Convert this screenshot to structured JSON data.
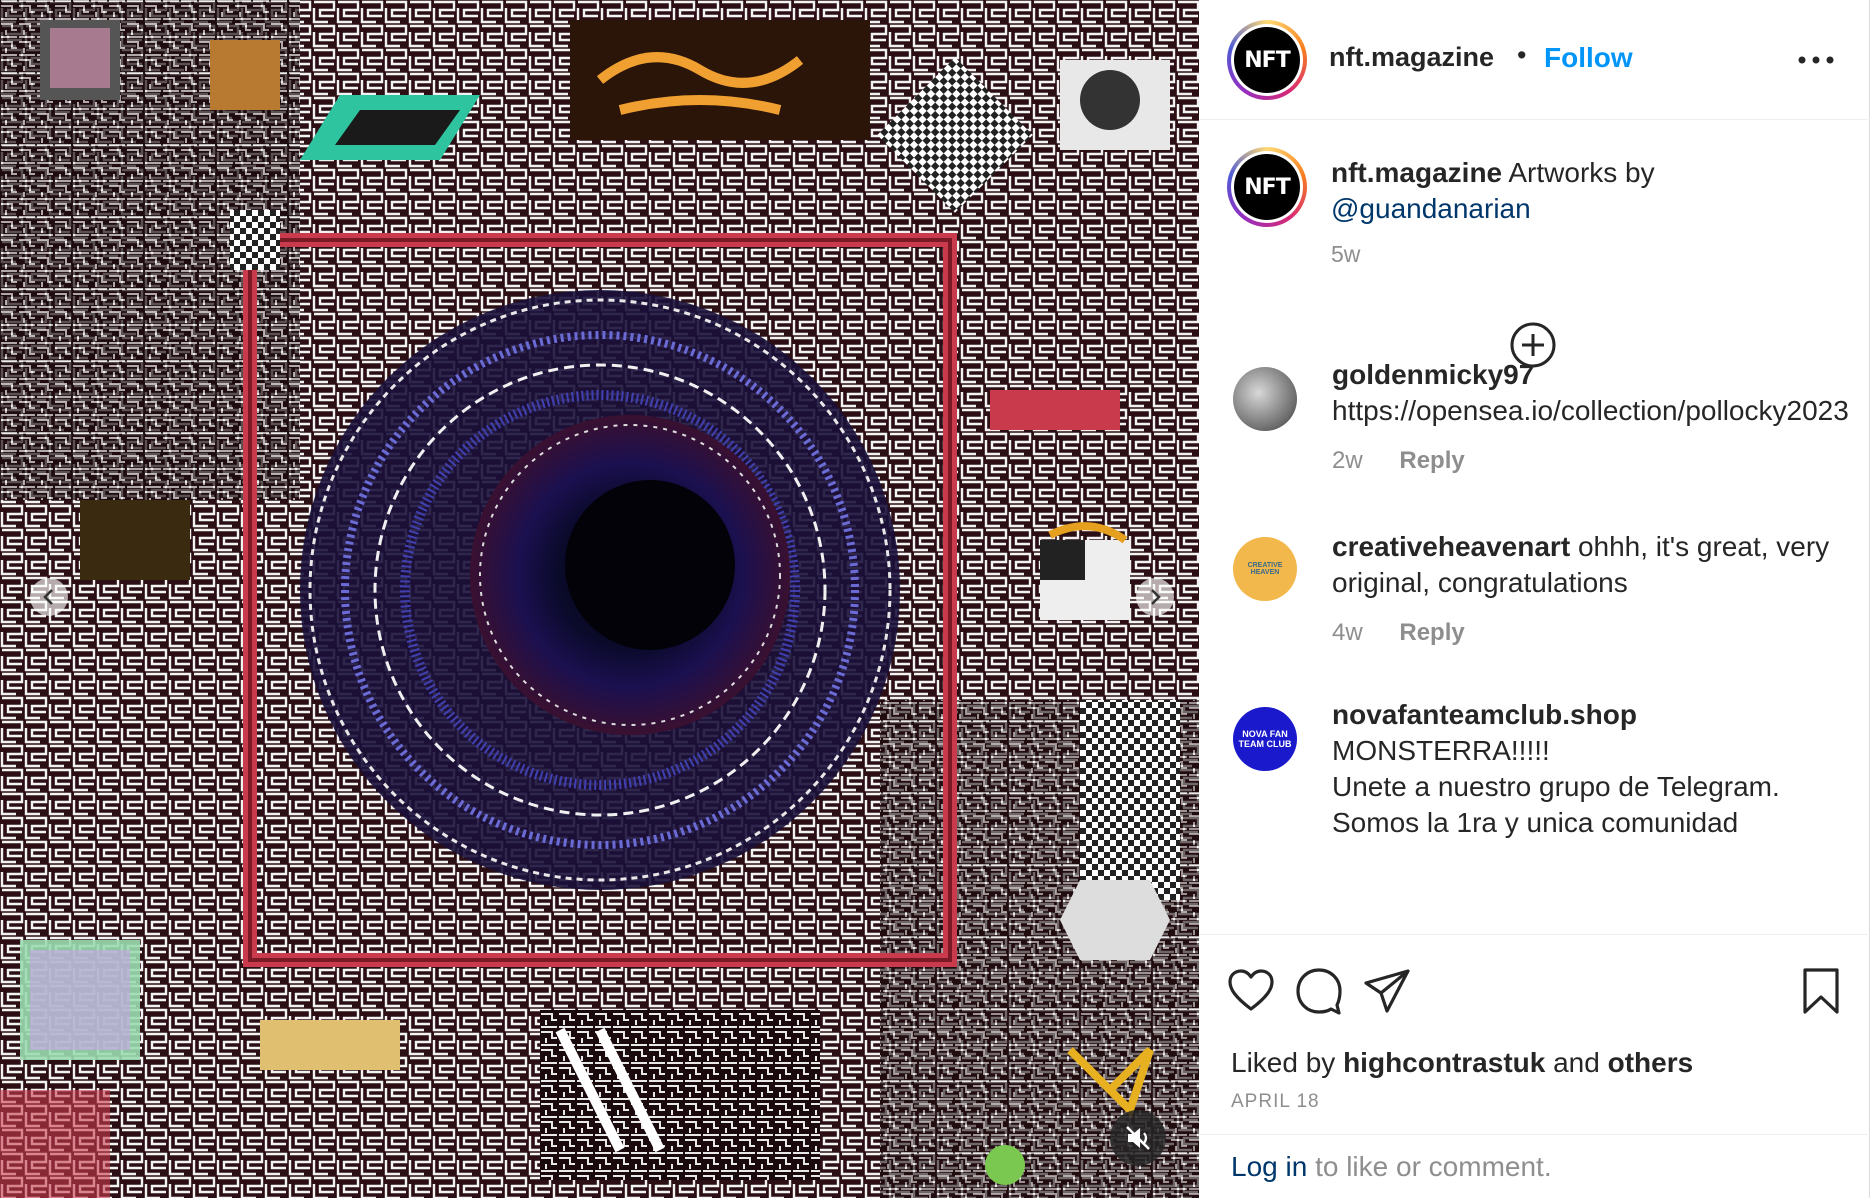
{
  "post": {
    "author": "nft.magazine",
    "avatar_text": "NFT",
    "separator": "•",
    "follow_label": "Follow",
    "caption_text": "Artworks by",
    "caption_mention": "@guandanarian",
    "caption_time": "5w",
    "liked_by_prefix": "Liked by",
    "liked_by_user": "highcontrastuk",
    "liked_by_and": "and",
    "liked_by_others": "others",
    "date": "APRIL 18"
  },
  "comments": [
    {
      "username": "goldenmicky97",
      "text": "https://opensea.io/collection/pollocky2023",
      "time": "2w",
      "reply_label": "Reply"
    },
    {
      "username": "creativeheavenart",
      "text": "ohhh, it's great, very original, congratulations",
      "time": "4w",
      "reply_label": "Reply",
      "avatar_text": "CREATIVE HEAVEN"
    },
    {
      "username": "novafanteamclub.shop",
      "text_line1": "MONSTERRA!!!!!",
      "text_line2": "Unete a nuestro grupo de Telegram.",
      "text_line3": "Somos la 1ra y unica comunidad",
      "avatar_text": "NOVA FAN TEAM CLUB"
    }
  ],
  "login": {
    "link_label": "Log in",
    "rest": "to like or comment."
  },
  "colors": {
    "follow": "#0095f6",
    "link": "#00376b",
    "muted": "#8e8e8e",
    "text": "#262626"
  },
  "icons": [
    "chevron-left-icon",
    "chevron-right-icon",
    "muted-speaker-icon",
    "more-options-icon",
    "add-circle-icon",
    "heart-icon",
    "comment-icon",
    "share-icon",
    "bookmark-icon"
  ]
}
